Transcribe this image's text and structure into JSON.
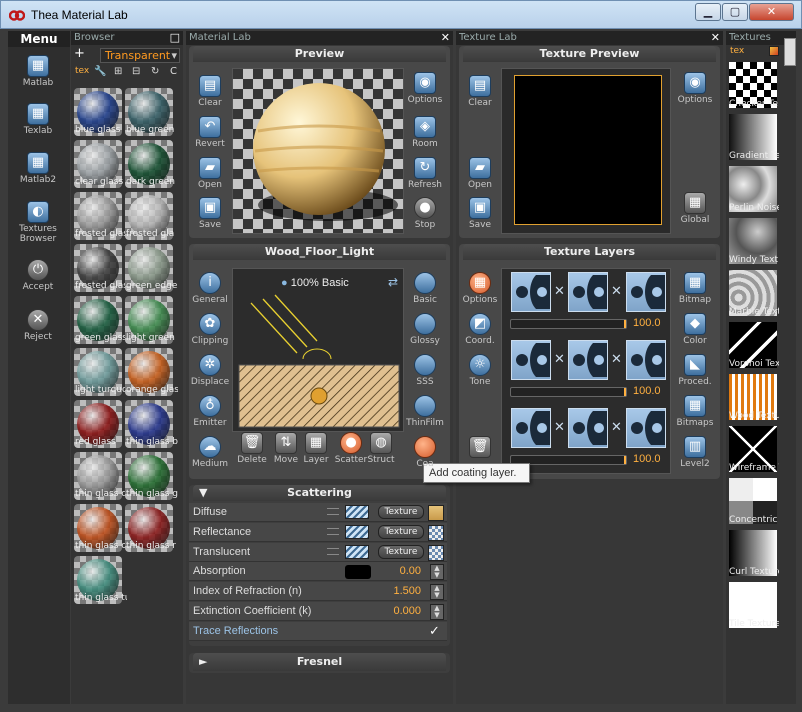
{
  "window": {
    "title": "Thea Material Lab",
    "min": "▁",
    "max": "▢",
    "close": "✕"
  },
  "menu": {
    "header": "Menu",
    "items": [
      {
        "label": "Matlab"
      },
      {
        "label": "Texlab"
      },
      {
        "label": "Matlab2"
      },
      {
        "label": "Textures Browser"
      },
      {
        "label": "Accept"
      },
      {
        "label": "Reject"
      }
    ]
  },
  "browser": {
    "title": "Browser",
    "category": "Transparent",
    "add": "+",
    "refresh_label": "C",
    "items": [
      {
        "label": "blue glass",
        "color": "#1a3a8a"
      },
      {
        "label": "blue green",
        "color": "#2f5a62"
      },
      {
        "label": "clear glass",
        "color": "#9aa0a4"
      },
      {
        "label": "dark green",
        "color": "#0e4a2a"
      },
      {
        "label": "frosted glas",
        "color": "#9a9a9a"
      },
      {
        "label": "frosted gla",
        "color": "#b6b6b6"
      },
      {
        "label": "frosted glas",
        "color": "#3a3a3a"
      },
      {
        "label": "green edge",
        "color": "#8a9a8a"
      },
      {
        "label": "green glass",
        "color": "#145a3a"
      },
      {
        "label": "light green",
        "color": "#3a8a4a"
      },
      {
        "label": "light turquoi",
        "color": "#6a9a9a"
      },
      {
        "label": "orange glass",
        "color": "#c85a14"
      },
      {
        "label": "red glass",
        "color": "#8a0e0e"
      },
      {
        "label": "thin glass b",
        "color": "#1e2e8a"
      },
      {
        "label": "thin glass cl",
        "color": "#9a9a9a"
      },
      {
        "label": "thin glass g",
        "color": "#1e6a2a"
      },
      {
        "label": "thin glass or",
        "color": "#c04a14"
      },
      {
        "label": "thin glass r",
        "color": "#8a1414"
      },
      {
        "label": "thin glass tu",
        "color": "#3a8a7a"
      }
    ]
  },
  "material_lab": {
    "title": "Material Lab",
    "preview": {
      "heading": "Preview",
      "left_tools": [
        "Clear",
        "Revert",
        "Open",
        "Save"
      ],
      "right_tools": [
        "Options",
        "Room",
        "Refresh",
        "Stop"
      ],
      "stop_badge": "STOP"
    },
    "material": {
      "heading": "Wood_Floor_Light",
      "layer_label": "100% Basic",
      "left_tools": [
        "General",
        "Clipping",
        "Displace",
        "Emitter",
        "Medium"
      ],
      "right_tools": [
        "Basic",
        "Glossy",
        "SSS",
        "ThinFilm",
        "Coa"
      ],
      "bottom_tools": [
        "Delete",
        "Move",
        "Layer",
        "Scatter",
        "Struct"
      ]
    },
    "scattering": {
      "heading": "Scattering",
      "rows": [
        {
          "label": "Diffuse",
          "texture_btn": "Texture"
        },
        {
          "label": "Reflectance",
          "texture_btn": "Texture"
        },
        {
          "label": "Translucent",
          "texture_btn": "Texture"
        },
        {
          "label": "Absorption",
          "value": "0.00"
        },
        {
          "label": "Index of Refraction (n)",
          "value": "1.500"
        },
        {
          "label": "Extinction Coefficient (k)",
          "value": "0.000"
        },
        {
          "label": "Trace Reflections",
          "checked": "✓"
        }
      ]
    },
    "fresnel": {
      "heading": "Fresnel"
    }
  },
  "texture_lab": {
    "title": "Texture Lab",
    "preview": {
      "heading": "Texture Preview",
      "left_tools": [
        "Clear",
        "Open",
        "Save"
      ],
      "right_tools": [
        "Options",
        "Global"
      ]
    },
    "layers": {
      "heading": "Texture Layers",
      "left_tools": [
        "Options",
        "Coord.",
        "Tone"
      ],
      "right_tools": [
        "Bitmap",
        "Color",
        "Proced.",
        "Bitmaps",
        "Level2"
      ],
      "rows": [
        {
          "value": "100.0"
        },
        {
          "value": "100.0"
        },
        {
          "value": "100.0"
        }
      ],
      "op": "✕"
    }
  },
  "textures": {
    "title": "Textures",
    "tab": "tex",
    "items": [
      "Checker Te",
      "Gradient Te",
      "Perlin Noise",
      "Windy Text",
      "Marble Text",
      "Voronoi Tex",
      "Wood Textu",
      "Wireframe T",
      "Concentric T",
      "Curl Texture",
      "Tile Texture"
    ]
  },
  "tooltip": "Add coating layer."
}
